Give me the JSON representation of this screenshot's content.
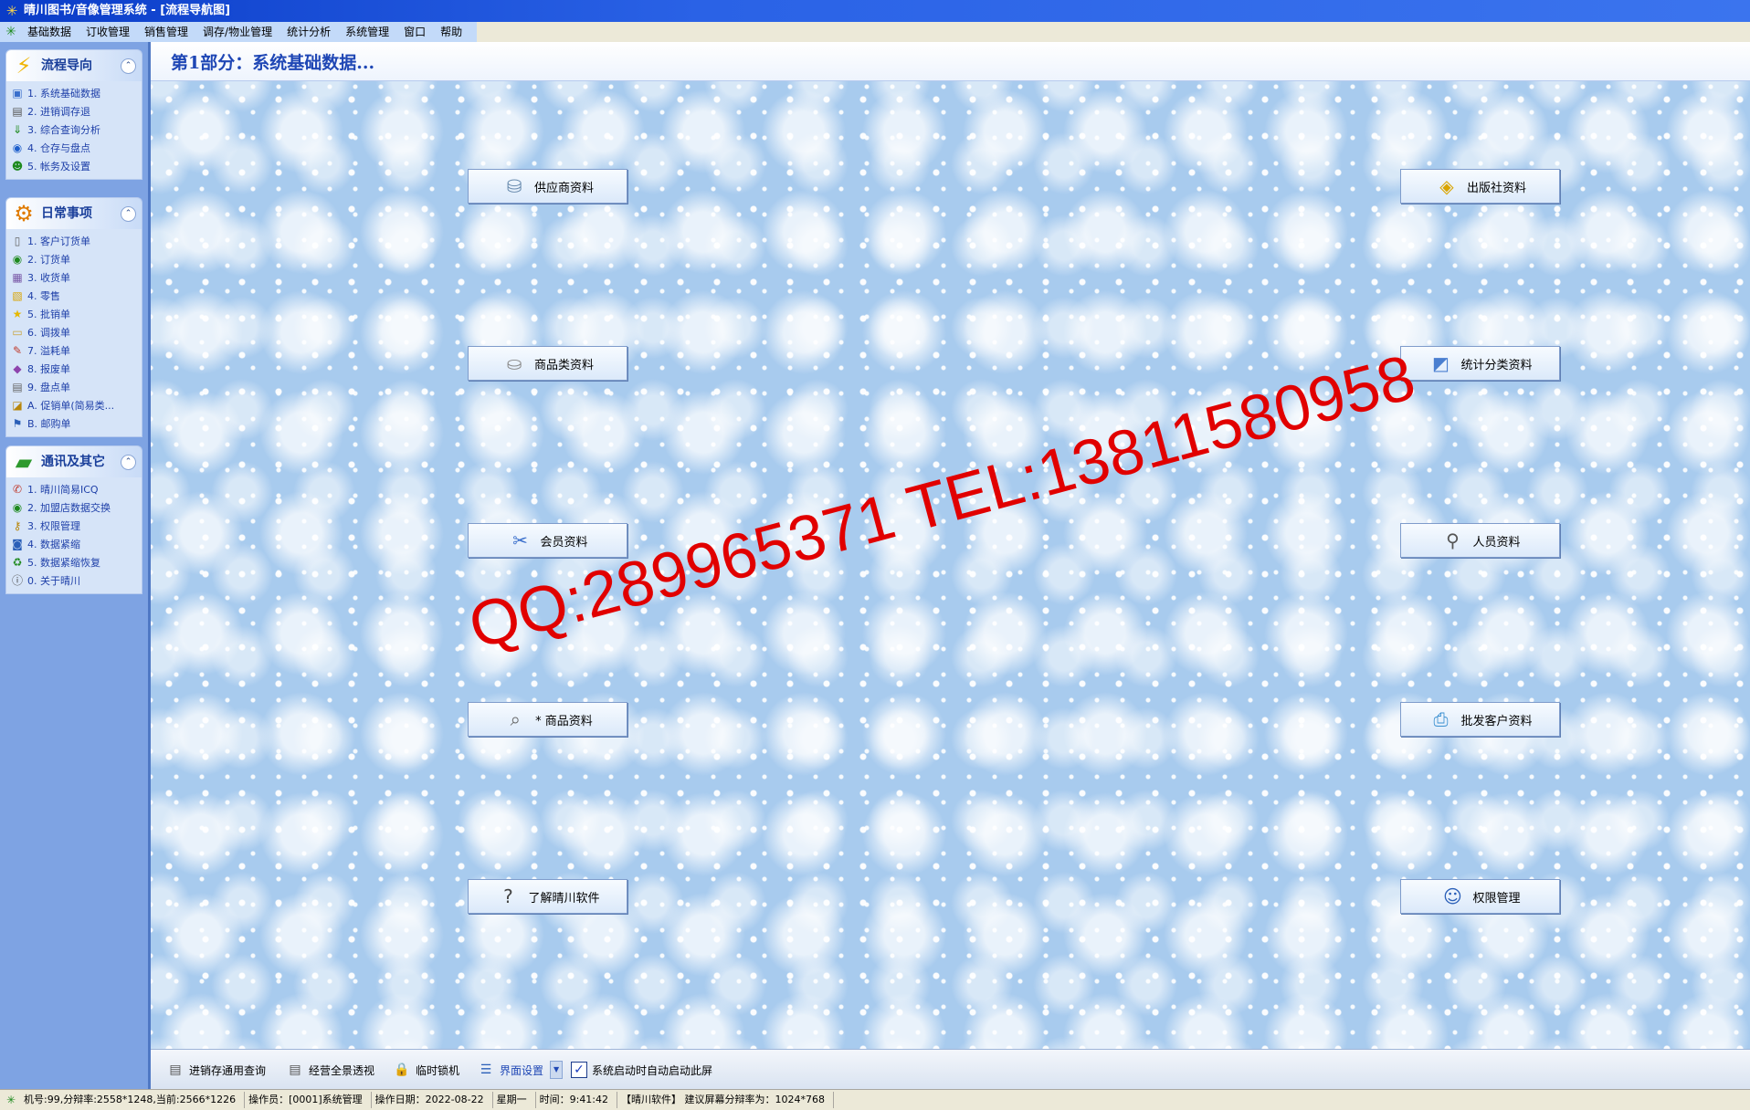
{
  "window": {
    "title": "晴川图书/音像管理系统 - [流程导航图]"
  },
  "menu": {
    "items": [
      "基础数据",
      "订收管理",
      "销售管理",
      "调存/物业管理",
      "统计分析",
      "系统管理",
      "窗口",
      "帮助"
    ]
  },
  "sidebar": {
    "panels": [
      {
        "title": "流程导向",
        "icon": "lightning-icon",
        "items": [
          {
            "label": "1. 系统基础数据",
            "icon": "database-icon"
          },
          {
            "label": "2. 进销调存退",
            "icon": "book-icon"
          },
          {
            "label": "3. 综合查询分析",
            "icon": "arrow-down-icon"
          },
          {
            "label": "4. 仓存与盘点",
            "icon": "globe-icon"
          },
          {
            "label": "5. 帐务及设置",
            "icon": "user-icon"
          }
        ]
      },
      {
        "title": "日常事项",
        "icon": "gear-icon",
        "items": [
          {
            "label": "1. 客户订货单",
            "icon": "document-icon"
          },
          {
            "label": "2. 订货单",
            "icon": "globe-icon"
          },
          {
            "label": "3. 收货单",
            "icon": "box-icon"
          },
          {
            "label": "4. 零售",
            "icon": "receipt-icon"
          },
          {
            "label": "5. 批销单",
            "icon": "star-icon"
          },
          {
            "label": "6. 调拨单",
            "icon": "folder-icon"
          },
          {
            "label": "7. 溢耗单",
            "icon": "pen-icon"
          },
          {
            "label": "8. 报废单",
            "icon": "cube-icon"
          },
          {
            "label": "9. 盘点单",
            "icon": "clipboard-icon"
          },
          {
            "label": "A. 促销单(简易类...",
            "icon": "tag-icon"
          },
          {
            "label": "B. 邮购单",
            "icon": "flag-icon"
          }
        ]
      },
      {
        "title": "通讯及其它",
        "icon": "folder-icon",
        "items": [
          {
            "label": "1. 晴川简易ICQ",
            "icon": "chat-icon"
          },
          {
            "label": "2. 加盟店数据交换",
            "icon": "globe-icon"
          },
          {
            "label": "3. 权限管理",
            "icon": "key-icon"
          },
          {
            "label": "4. 数据紧缩",
            "icon": "disk-icon"
          },
          {
            "label": "5. 数据紧缩恢复",
            "icon": "recycle-icon"
          },
          {
            "label": "0. 关于晴川",
            "icon": "info-icon"
          }
        ]
      }
    ]
  },
  "main": {
    "heading": "第1部分：系统基础数据...",
    "buttons": [
      {
        "label": "供应商资料",
        "icon": "cylinder-icon"
      },
      {
        "label": "出版社资料",
        "icon": "publisher-icon"
      },
      {
        "label": "商品类资料",
        "icon": "coins-icon"
      },
      {
        "label": "统计分类资料",
        "icon": "chart-icon"
      },
      {
        "label": "会员资料",
        "icon": "tools-icon"
      },
      {
        "label": "人员资料",
        "icon": "people-icon"
      },
      {
        "label": "* 商品资料",
        "icon": "magnifier-icon"
      },
      {
        "label": "批发客户资料",
        "icon": "printer-icon"
      },
      {
        "label": "了解晴川软件",
        "icon": "help-icon"
      },
      {
        "label": "权限管理",
        "icon": "user-settings-icon"
      }
    ],
    "watermark": "QQ:289965371 TEL:13811580958"
  },
  "toolbar": {
    "items": [
      {
        "label": "进销存通用查询",
        "icon": "document-icon"
      },
      {
        "label": "经营全景透视",
        "icon": "document-icon"
      },
      {
        "label": "临时锁机",
        "icon": "lock-icon"
      },
      {
        "label": "界面设置",
        "icon": "list-icon"
      }
    ],
    "checkbox_label": "系统启动时自动启动此屏",
    "checkbox_checked": true
  },
  "status": {
    "cells": [
      "机号:99,分辩率:2558*1248,当前:2566*1226",
      "操作员：[0001]系统管理",
      "操作日期：2022-08-22",
      "星期一",
      "时间：9:41:42",
      "【晴川软件】 建议屏幕分辩率为：1024*768"
    ]
  },
  "colors": {
    "titlebar": "#2a62e6",
    "sidebar": "#7ea3e3",
    "heading": "#1f47b5",
    "watermark": "#e10000"
  }
}
